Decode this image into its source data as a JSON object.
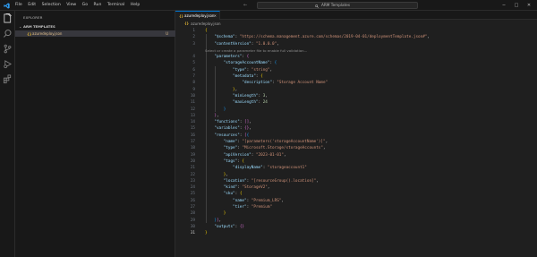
{
  "menu": [
    "File",
    "Edit",
    "Selection",
    "View",
    "Go",
    "Run",
    "Terminal",
    "Help"
  ],
  "search": {
    "text": "ARM Templates"
  },
  "colors": {
    "accent": "#0078d4",
    "modified": "#e2c08d",
    "background": "#1f1f1f"
  },
  "sidebar": {
    "title": "EXPLORER",
    "folder": "ARM TEMPLATES",
    "files": [
      {
        "name": "azuredeploy.json",
        "status": "U"
      }
    ]
  },
  "editor": {
    "tab": "azuredeploy.json",
    "breadcrumb": "azuredeploy.json",
    "hint": "Select or create a parameter file to enable full validation...",
    "line_numbers": [
      "1",
      "2",
      "3",
      "4",
      "5",
      "6",
      "7",
      "8",
      "9",
      "10",
      "11",
      "12",
      "13",
      "14",
      "15",
      "16",
      "17",
      "18",
      "19",
      "20",
      "21",
      "22",
      "23",
      "24",
      "25",
      "26",
      "27",
      "28",
      "29",
      "30",
      "31"
    ],
    "lines": [
      "{",
      "    \"$schema\": \"https://schema.management.azure.com/schemas/2019-04-01/deploymentTemplate.json#\",",
      "    \"contentVersion\": \"1.0.0.0\",",
      "    \"parameters\": {",
      "        \"storageAccountName\": {",
      "            \"type\": \"string\",",
      "            \"metadata\": {",
      "                \"description\": \"Storage Account Name\"",
      "            },",
      "            \"minLength\": 3,",
      "            \"maxLength\": 24",
      "        }",
      "    },",
      "    \"functions\": [],",
      "    \"variables\": {},",
      "    \"resources\": [{",
      "        \"name\": \"[parameters('storageAccountName')]\",",
      "        \"type\": \"Microsoft.Storage/storageAccounts\",",
      "        \"apiVersion\": \"2023-01-01\",",
      "        \"tags\": {",
      "            \"displayName\": \"storageaccount1\"",
      "        },",
      "        \"location\": \"[resourceGroup().location]\",",
      "        \"kind\": \"StorageV2\",",
      "        \"sku\": {",
      "            \"name\": \"Premium_LRS\",",
      "            \"tier\": \"Premium\"",
      "        }",
      "    }],",
      "    \"outputs\": {}",
      "}"
    ]
  }
}
